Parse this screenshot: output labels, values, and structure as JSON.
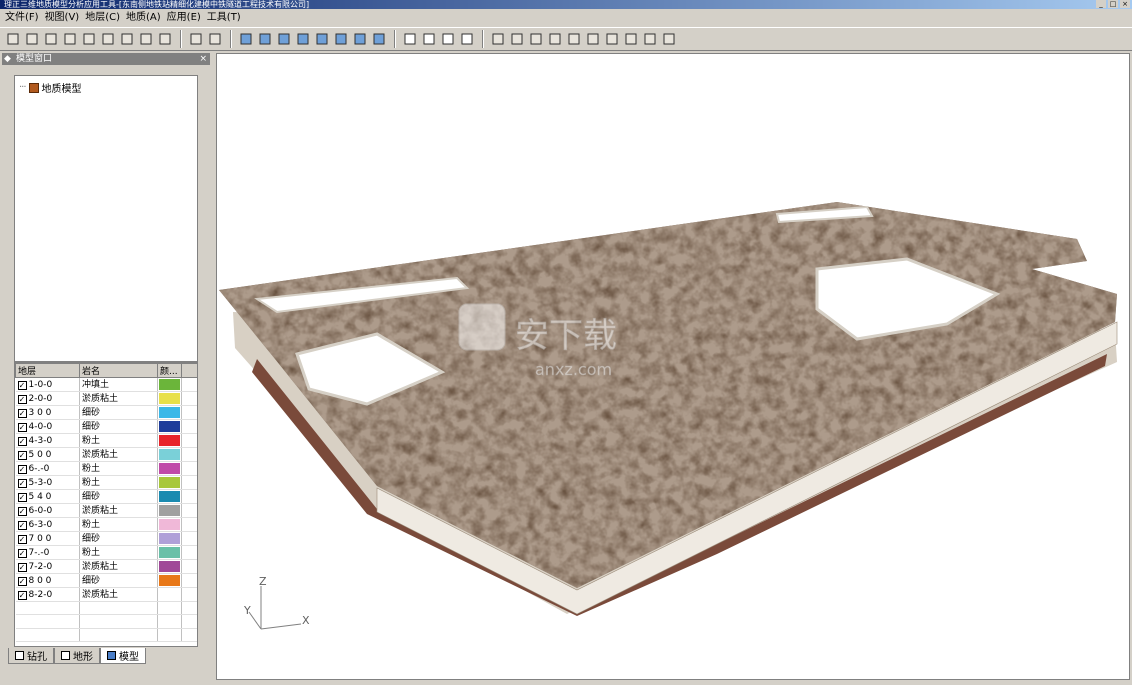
{
  "window": {
    "title": "理正三维地质模型分析应用工具-[东南侧地铁站精细化建模中铁隧道工程技术有限公司]"
  },
  "menu": [
    "文件(F)",
    "视图(V)",
    "地层(C)",
    "地质(A)",
    "应用(E)",
    "工具(T)"
  ],
  "toolbar": {
    "icons": [
      "open-icon",
      "save-icon",
      "import-icon",
      "export-icon",
      "print-icon",
      "borehole-icon",
      "section-icon",
      "chart-icon",
      "grid-icon",
      "view-top-icon",
      "view-front-icon",
      "cube1-icon",
      "cube2-icon",
      "cube3-icon",
      "cube4-icon",
      "cube5-icon",
      "cube6-icon",
      "cube-solid-icon",
      "cube-color-icon",
      "zoom-in-icon",
      "zoom-out-icon",
      "zoom-window-icon",
      "zoom-all-icon",
      "select-icon",
      "pan-icon",
      "rotate-icon",
      "rotate-x-icon",
      "rotate-y-icon",
      "rotate-z-icon",
      "arrow-right-icon",
      "arrow-left-icon",
      "arrow-up-icon",
      "arrow-down-icon"
    ]
  },
  "panel": {
    "title": "模型窗口",
    "tree_root": "地质模型"
  },
  "layers": {
    "headers": [
      "地层",
      "岩名",
      "颜..."
    ],
    "rows": [
      {
        "id": "1-0-0",
        "name": "冲填土",
        "color": "#6bb53a"
      },
      {
        "id": "2-0-0",
        "name": "淤质粘土",
        "color": "#e8e04a"
      },
      {
        "id": "3 0 0",
        "name": "细砂",
        "color": "#3ab8e8"
      },
      {
        "id": "4-0-0",
        "name": "细砂",
        "color": "#1e3c9a"
      },
      {
        "id": "4-3-0",
        "name": "粉土",
        "color": "#e8242a"
      },
      {
        "id": "5 0 0",
        "name": "淤质粘土",
        "color": "#7ad0d8"
      },
      {
        "id": "6-.-0",
        "name": "粉土",
        "color": "#c04aa8"
      },
      {
        "id": "5-3-0",
        "name": "粉土",
        "color": "#a8c83a"
      },
      {
        "id": "5 4 0",
        "name": "细砂",
        "color": "#1a8ab0"
      },
      {
        "id": "6-0-0",
        "name": "淤质粘土",
        "color": "#a0a0a0"
      },
      {
        "id": "6-3-0",
        "name": "粉土",
        "color": "#f0b8d8"
      },
      {
        "id": "7 0 0",
        "name": "细砂",
        "color": "#b0a0d8"
      },
      {
        "id": "7-.-0",
        "name": "粉土",
        "color": "#6ac0a8"
      },
      {
        "id": "7-2-0",
        "name": "淤质粘土",
        "color": "#a04898"
      },
      {
        "id": "8 0 0",
        "name": "细砂",
        "color": "#e87818"
      },
      {
        "id": "8-2-0",
        "name": "淤质粘土",
        "color": "#ffffff"
      }
    ]
  },
  "tabs": [
    "钻孔",
    "地形",
    "模型"
  ],
  "viewport": {
    "axis_labels": {
      "z": "Z",
      "y": "Y",
      "x": "X"
    },
    "watermark": "安下载",
    "watermark_url": "anxz.com"
  },
  "colors": {
    "soil_top": "#6a5442",
    "soil_side": "#efeae2",
    "soil_bottom": "#7a4a3a"
  }
}
